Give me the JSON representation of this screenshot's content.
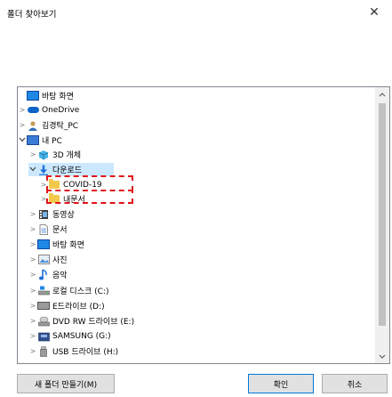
{
  "window": {
    "title": "폴더 찾아보기",
    "close_glyph": "✕"
  },
  "tree": {
    "items": [
      {
        "label": "바탕 화면",
        "icon": "desktop-icon",
        "chevron": ""
      },
      {
        "label": "OneDrive",
        "icon": "onedrive-cloud-icon",
        "chevron": ">"
      },
      {
        "label": "김경탁_PC",
        "icon": "user-icon",
        "chevron": ">"
      },
      {
        "label": "내 PC",
        "icon": "this-pc-icon",
        "chevron": "v"
      },
      {
        "label": "3D 개체",
        "icon": "3d-objects-icon",
        "chevron": ">"
      },
      {
        "label": "다운로드",
        "icon": "downloads-icon",
        "chevron": "v"
      },
      {
        "label": "COVID-19",
        "icon": "folder-icon",
        "chevron": ">"
      },
      {
        "label": "내문서",
        "icon": "folder-icon",
        "chevron": ">"
      },
      {
        "label": "동영상",
        "icon": "videos-icon",
        "chevron": ">"
      },
      {
        "label": "문서",
        "icon": "documents-icon",
        "chevron": ">"
      },
      {
        "label": "바탕 화면",
        "icon": "desktop-icon",
        "chevron": ">"
      },
      {
        "label": "사진",
        "icon": "pictures-icon",
        "chevron": ">"
      },
      {
        "label": "음악",
        "icon": "music-icon",
        "chevron": ">"
      },
      {
        "label": "로컬 디스크 (C:)",
        "icon": "local-disk-icon",
        "chevron": ">"
      },
      {
        "label": "E드라이브 (D:)",
        "icon": "drive-icon",
        "chevron": ">"
      },
      {
        "label": "DVD RW 드라이브 (E:)",
        "icon": "dvd-drive-icon",
        "chevron": ">"
      },
      {
        "label": "SAMSUNG (G:)",
        "icon": "usb-drive-icon",
        "chevron": ">"
      },
      {
        "label": "USB 드라이브 (H:)",
        "icon": "usb-drive-icon",
        "chevron": ">"
      }
    ]
  },
  "buttons": {
    "new_folder": "새 폴더 만들기(M)",
    "ok": "확인",
    "cancel": "취소"
  },
  "colors": {
    "highlight_box": "#e0141a",
    "selected_bg": "#cce8ff",
    "accent": "#0078d7"
  }
}
